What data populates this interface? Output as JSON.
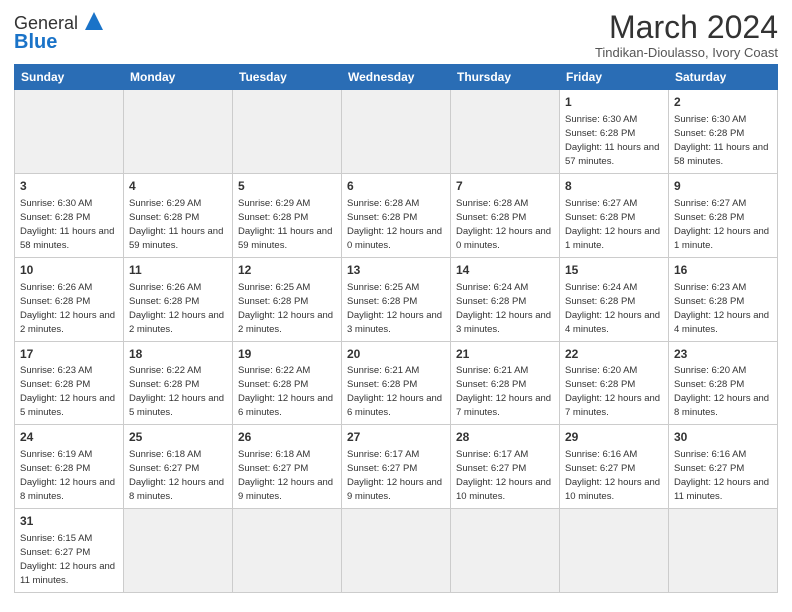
{
  "logo": {
    "text_general": "General",
    "text_blue": "Blue"
  },
  "header": {
    "month_year": "March 2024",
    "location": "Tindikan-Dioulasso, Ivory Coast"
  },
  "days_of_week": [
    "Sunday",
    "Monday",
    "Tuesday",
    "Wednesday",
    "Thursday",
    "Friday",
    "Saturday"
  ],
  "weeks": [
    [
      {
        "day": "",
        "empty": true
      },
      {
        "day": "",
        "empty": true
      },
      {
        "day": "",
        "empty": true
      },
      {
        "day": "",
        "empty": true
      },
      {
        "day": "",
        "empty": true
      },
      {
        "day": "1",
        "sunrise": "6:30 AM",
        "sunset": "6:28 PM",
        "daylight": "11 hours and 57 minutes."
      },
      {
        "day": "2",
        "sunrise": "6:30 AM",
        "sunset": "6:28 PM",
        "daylight": "11 hours and 58 minutes."
      }
    ],
    [
      {
        "day": "3",
        "sunrise": "6:30 AM",
        "sunset": "6:28 PM",
        "daylight": "11 hours and 58 minutes."
      },
      {
        "day": "4",
        "sunrise": "6:29 AM",
        "sunset": "6:28 PM",
        "daylight": "11 hours and 59 minutes."
      },
      {
        "day": "5",
        "sunrise": "6:29 AM",
        "sunset": "6:28 PM",
        "daylight": "11 hours and 59 minutes."
      },
      {
        "day": "6",
        "sunrise": "6:28 AM",
        "sunset": "6:28 PM",
        "daylight": "12 hours and 0 minutes."
      },
      {
        "day": "7",
        "sunrise": "6:28 AM",
        "sunset": "6:28 PM",
        "daylight": "12 hours and 0 minutes."
      },
      {
        "day": "8",
        "sunrise": "6:27 AM",
        "sunset": "6:28 PM",
        "daylight": "12 hours and 1 minute."
      },
      {
        "day": "9",
        "sunrise": "6:27 AM",
        "sunset": "6:28 PM",
        "daylight": "12 hours and 1 minute."
      }
    ],
    [
      {
        "day": "10",
        "sunrise": "6:26 AM",
        "sunset": "6:28 PM",
        "daylight": "12 hours and 2 minutes."
      },
      {
        "day": "11",
        "sunrise": "6:26 AM",
        "sunset": "6:28 PM",
        "daylight": "12 hours and 2 minutes."
      },
      {
        "day": "12",
        "sunrise": "6:25 AM",
        "sunset": "6:28 PM",
        "daylight": "12 hours and 2 minutes."
      },
      {
        "day": "13",
        "sunrise": "6:25 AM",
        "sunset": "6:28 PM",
        "daylight": "12 hours and 3 minutes."
      },
      {
        "day": "14",
        "sunrise": "6:24 AM",
        "sunset": "6:28 PM",
        "daylight": "12 hours and 3 minutes."
      },
      {
        "day": "15",
        "sunrise": "6:24 AM",
        "sunset": "6:28 PM",
        "daylight": "12 hours and 4 minutes."
      },
      {
        "day": "16",
        "sunrise": "6:23 AM",
        "sunset": "6:28 PM",
        "daylight": "12 hours and 4 minutes."
      }
    ],
    [
      {
        "day": "17",
        "sunrise": "6:23 AM",
        "sunset": "6:28 PM",
        "daylight": "12 hours and 5 minutes."
      },
      {
        "day": "18",
        "sunrise": "6:22 AM",
        "sunset": "6:28 PM",
        "daylight": "12 hours and 5 minutes."
      },
      {
        "day": "19",
        "sunrise": "6:22 AM",
        "sunset": "6:28 PM",
        "daylight": "12 hours and 6 minutes."
      },
      {
        "day": "20",
        "sunrise": "6:21 AM",
        "sunset": "6:28 PM",
        "daylight": "12 hours and 6 minutes."
      },
      {
        "day": "21",
        "sunrise": "6:21 AM",
        "sunset": "6:28 PM",
        "daylight": "12 hours and 7 minutes."
      },
      {
        "day": "22",
        "sunrise": "6:20 AM",
        "sunset": "6:28 PM",
        "daylight": "12 hours and 7 minutes."
      },
      {
        "day": "23",
        "sunrise": "6:20 AM",
        "sunset": "6:28 PM",
        "daylight": "12 hours and 8 minutes."
      }
    ],
    [
      {
        "day": "24",
        "sunrise": "6:19 AM",
        "sunset": "6:28 PM",
        "daylight": "12 hours and 8 minutes."
      },
      {
        "day": "25",
        "sunrise": "6:18 AM",
        "sunset": "6:27 PM",
        "daylight": "12 hours and 8 minutes."
      },
      {
        "day": "26",
        "sunrise": "6:18 AM",
        "sunset": "6:27 PM",
        "daylight": "12 hours and 9 minutes."
      },
      {
        "day": "27",
        "sunrise": "6:17 AM",
        "sunset": "6:27 PM",
        "daylight": "12 hours and 9 minutes."
      },
      {
        "day": "28",
        "sunrise": "6:17 AM",
        "sunset": "6:27 PM",
        "daylight": "12 hours and 10 minutes."
      },
      {
        "day": "29",
        "sunrise": "6:16 AM",
        "sunset": "6:27 PM",
        "daylight": "12 hours and 10 minutes."
      },
      {
        "day": "30",
        "sunrise": "6:16 AM",
        "sunset": "6:27 PM",
        "daylight": "12 hours and 11 minutes."
      }
    ],
    [
      {
        "day": "31",
        "sunrise": "6:15 AM",
        "sunset": "6:27 PM",
        "daylight": "12 hours and 11 minutes."
      },
      {
        "day": "",
        "empty": true
      },
      {
        "day": "",
        "empty": true
      },
      {
        "day": "",
        "empty": true
      },
      {
        "day": "",
        "empty": true
      },
      {
        "day": "",
        "empty": true
      },
      {
        "day": "",
        "empty": true
      }
    ]
  ]
}
